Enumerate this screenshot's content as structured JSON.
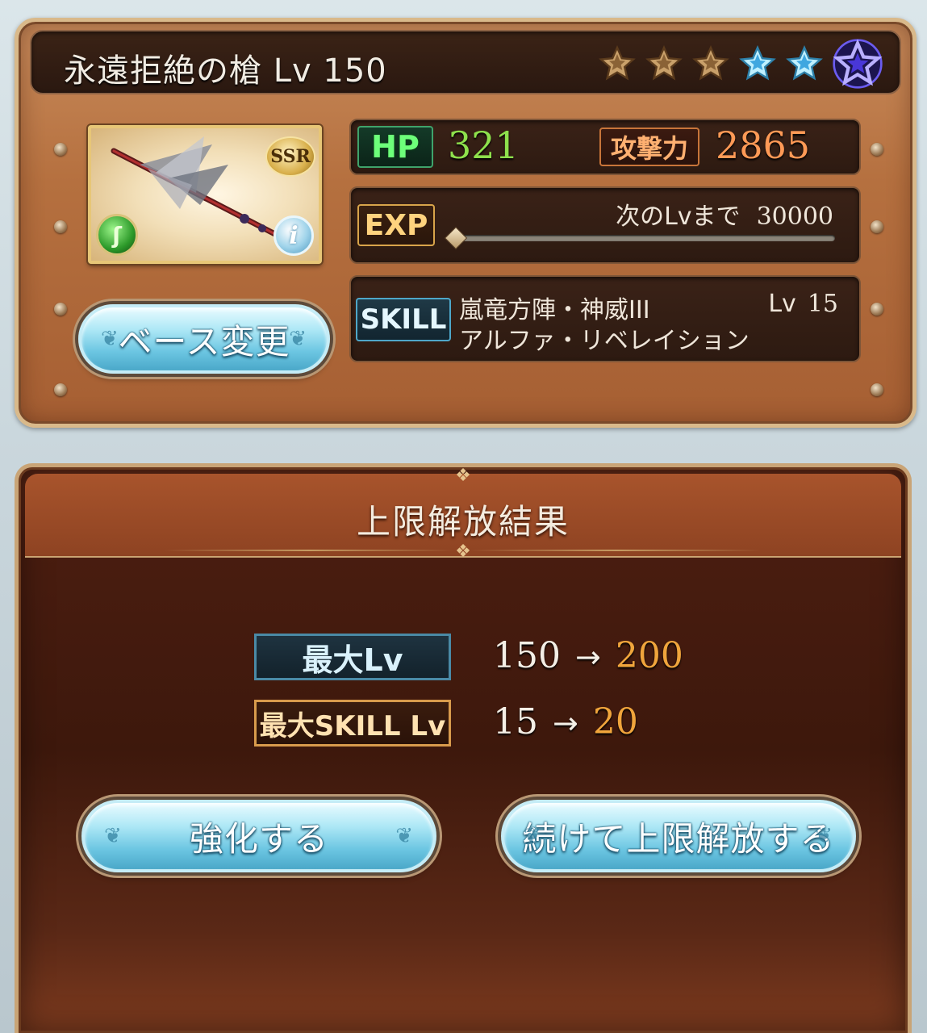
{
  "weapon": {
    "title": "永遠拒絶の槍 Lv 150",
    "rarity": "SSR",
    "element_icon": "wind-element-icon",
    "stars": [
      {
        "type": "bronze",
        "color": "#b08a5a"
      },
      {
        "type": "bronze",
        "color": "#b08a5a"
      },
      {
        "type": "bronze",
        "color": "#b08a5a"
      },
      {
        "type": "blue",
        "color": "#7fd6ff"
      },
      {
        "type": "blue",
        "color": "#7fd6ff"
      },
      {
        "type": "purple-large",
        "color": "#5b48e8"
      }
    ]
  },
  "stats": {
    "hp_label": "HP",
    "hp_value": "321",
    "atk_label": "攻撃力",
    "atk_value": "2865",
    "exp_label": "EXP",
    "next_lv_label": "次のLvまで",
    "next_lv_value": "30000",
    "exp_progress": 0.0
  },
  "skill": {
    "label": "SKILL",
    "name": "嵐竜方陣・神威III",
    "lv_label": "Lv",
    "lv_value": "15",
    "sub": "アルファ・リベレイション"
  },
  "buttons": {
    "base_change": "ベース変更",
    "enhance": "強化する",
    "continue_uncap": "続けて上限解放する"
  },
  "result": {
    "title": "上限解放結果",
    "max_lv_label": "最大Lv",
    "max_lv_old": "150",
    "max_lv_new": "200",
    "max_skill_label": "最大SKILL Lv",
    "max_skill_old": "15",
    "max_skill_new": "20",
    "arrow": "→"
  },
  "colors": {
    "hp_value": "#8ee04c",
    "atk_value": "#ff9a56",
    "new_value": "#f0a53c"
  }
}
